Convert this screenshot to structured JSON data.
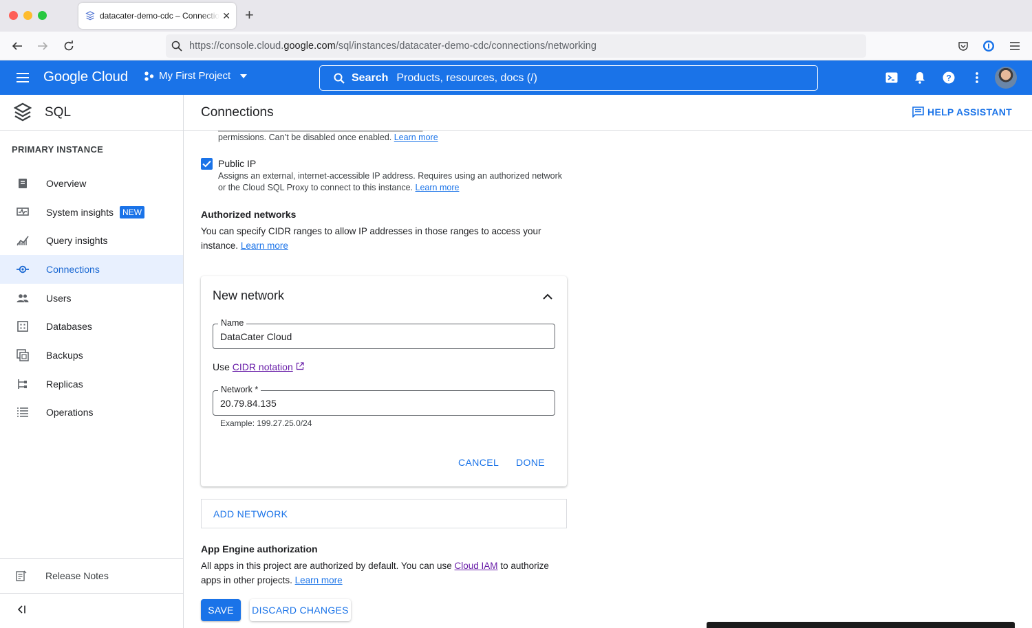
{
  "browser": {
    "tab_title": "datacater-demo-cdc – Connections",
    "url_prefix": "https://console.cloud.",
    "url_domain": "google.com",
    "url_path": "/sql/instances/datacater-demo-cdc/connections/networking"
  },
  "topbar": {
    "brand": "Google Cloud",
    "project": "My First Project",
    "search_label": "Search",
    "search_placeholder": "Products, resources, docs (/)"
  },
  "sidenav": {
    "product": "SQL",
    "section": "PRIMARY INSTANCE",
    "items": [
      {
        "label": "Overview",
        "icon": "overview-icon"
      },
      {
        "label": "System insights",
        "icon": "monitor-icon",
        "badge": "NEW"
      },
      {
        "label": "Query insights",
        "icon": "query-insights-icon"
      },
      {
        "label": "Connections",
        "icon": "connections-icon",
        "active": true
      },
      {
        "label": "Users",
        "icon": "users-icon"
      },
      {
        "label": "Databases",
        "icon": "databases-icon"
      },
      {
        "label": "Backups",
        "icon": "backups-icon"
      },
      {
        "label": "Replicas",
        "icon": "replicas-icon"
      },
      {
        "label": "Operations",
        "icon": "operations-icon"
      }
    ],
    "release_notes": "Release Notes"
  },
  "page": {
    "title": "Connections",
    "help_assistant": "HELP ASSISTANT"
  },
  "content": {
    "cut_text": "▬▬▬▬▬▬▬▬▬▬▬▬▬▬▬▬▬▬▬▬▬▬▬▬▬▬▬▬▬▬▬",
    "permissions_text": "permissions. Can’t be disabled once enabled.",
    "learn_more": "Learn more",
    "public_ip": {
      "label": "Public IP",
      "checked": true,
      "desc": "Assigns an external, internet-accessible IP address. Requires using an authorized network or the Cloud SQL Proxy to connect to this instance."
    },
    "authorized": {
      "heading": "Authorized networks",
      "desc": "You can specify CIDR ranges to allow IP addresses in those ranges to access your instance."
    },
    "new_network": {
      "title": "New network",
      "name_label": "Name",
      "name_value": "DataCater Cloud",
      "use_text": "Use",
      "cidr_link": "CIDR notation",
      "network_label": "Network *",
      "network_value": "20.79.84.135",
      "example": "Example: 199.27.25.0/24",
      "cancel": "CANCEL",
      "done": "DONE"
    },
    "add_network": "ADD NETWORK",
    "app_engine": {
      "heading": "App Engine authorization",
      "desc_before": "All apps in this project are authorized by default. You can use",
      "iam_link": "Cloud IAM",
      "desc_after": "to authorize apps in other projects."
    },
    "save": "SAVE",
    "discard": "DISCARD CHANGES"
  },
  "colors": {
    "primary": "#1a73e8",
    "visited_link": "#681da8",
    "active_nav_bg": "#e8f0fe"
  }
}
